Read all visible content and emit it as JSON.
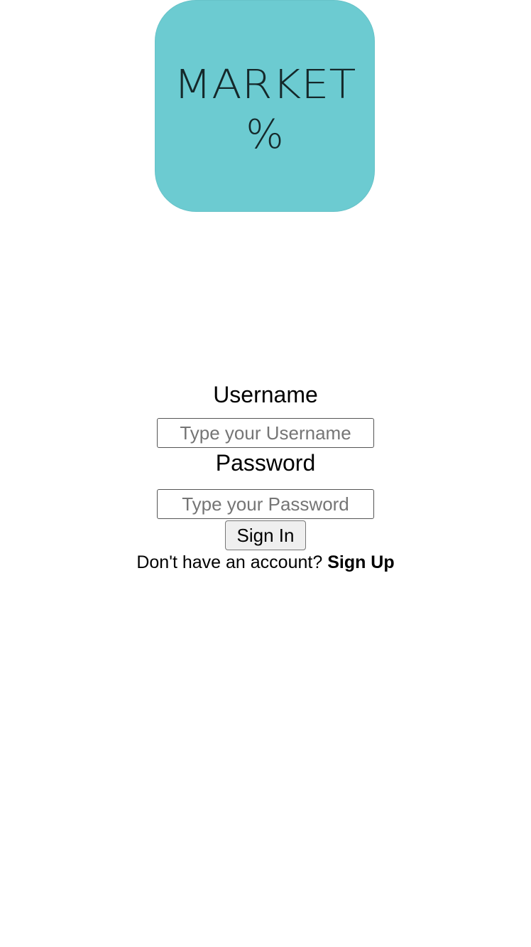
{
  "logo": {
    "word": "MARKET",
    "symbol": "%",
    "background_color": "#6ccbd1",
    "text_color": "#15282a"
  },
  "form": {
    "username_label": "Username",
    "username_placeholder": "Type your Username",
    "username_value": "",
    "password_label": "Password",
    "password_placeholder": "Type your Password",
    "password_value": "",
    "submit_label": "Sign In",
    "signup_prompt": "Don't have an account?",
    "signup_link": "Sign Up"
  }
}
